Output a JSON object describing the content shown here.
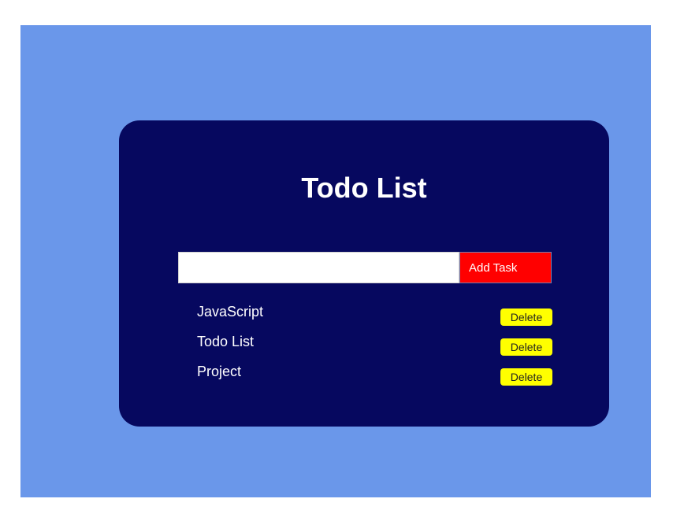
{
  "app": {
    "title": "Todo List"
  },
  "form": {
    "input_value": "",
    "input_placeholder": "",
    "add_button_label": "Add Task"
  },
  "tasks": [
    {
      "text": "JavaScript",
      "delete_label": "Delete"
    },
    {
      "text": "Todo List",
      "delete_label": "Delete"
    },
    {
      "text": "Project",
      "delete_label": "Delete"
    }
  ],
  "colors": {
    "page_background": "#6a97ea",
    "card_background": "#06085f",
    "add_button": "#ff0000",
    "delete_button": "#ffff00",
    "text": "#ffffff"
  }
}
